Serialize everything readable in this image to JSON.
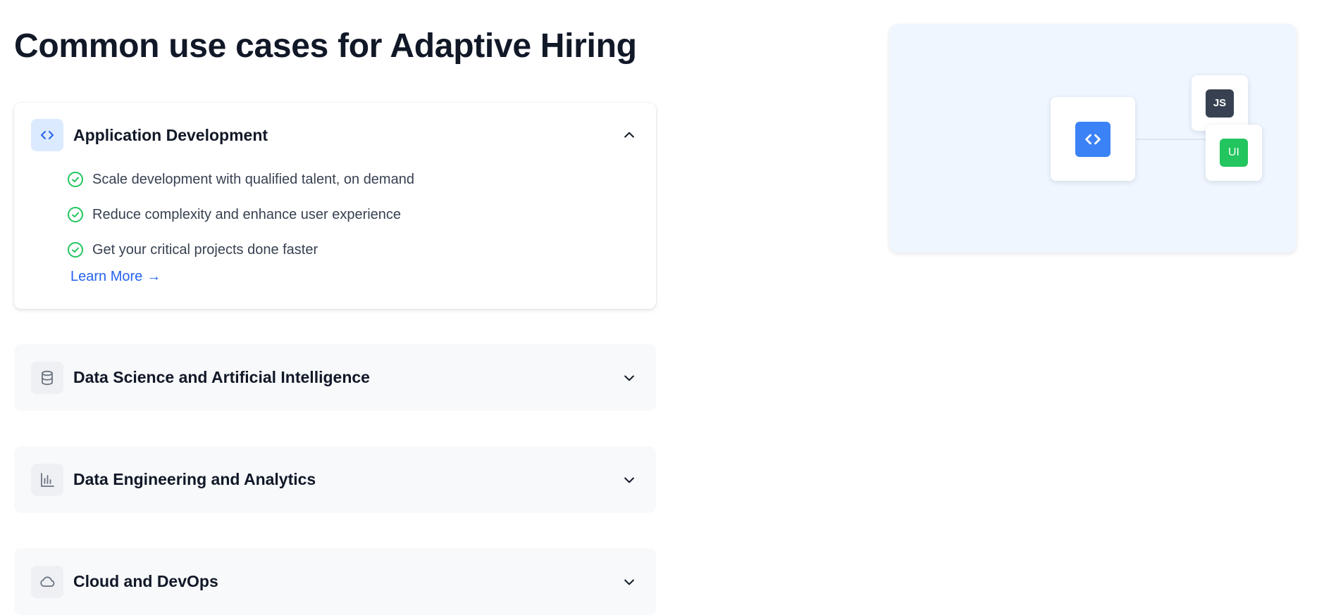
{
  "page": {
    "title": "Common use cases for Adaptive Hiring"
  },
  "cards": [
    {
      "title": "Application Development",
      "icon": "code-icon",
      "expanded": true,
      "bullets": [
        "Scale development with qualified talent, on demand",
        "Reduce complexity and enhance user experience",
        "Get your critical projects done faster"
      ],
      "link": "Learn More",
      "link_arrow": "→"
    },
    {
      "title": "Data Science and Artificial Intelligence",
      "icon": "database-icon",
      "expanded": false
    },
    {
      "title": "Data Engineering and Analytics",
      "icon": "bar-chart-icon",
      "expanded": false
    },
    {
      "title": "Cloud and DevOps",
      "icon": "cloud-icon",
      "expanded": false
    }
  ],
  "illustration": {
    "js_badge": "JS",
    "ui_badge": "UI",
    "colors": {
      "code_tile": "#3b82f6",
      "js_tile": "#374151",
      "ui_tile": "#22c55e",
      "panel_bg": "#eff6ff"
    }
  },
  "colors": {
    "accent": "#2563eb",
    "check": "#22c55e",
    "heading": "#111827"
  }
}
